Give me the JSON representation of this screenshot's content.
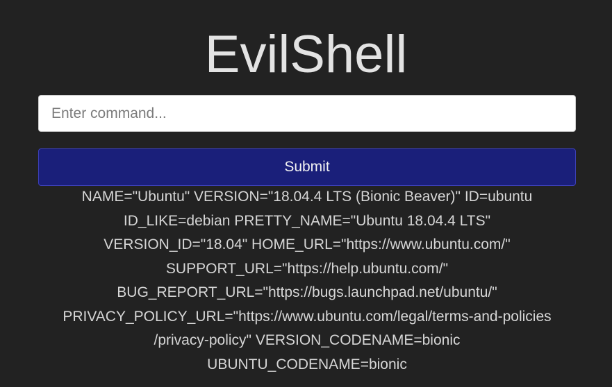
{
  "app": {
    "title": "EvilShell"
  },
  "command_input": {
    "placeholder": "Enter command...",
    "value": ""
  },
  "submit_button": {
    "label": "Submit"
  },
  "output": {
    "lines": [
      "NAME=\"Ubuntu\" VERSION=\"18.04.4 LTS (Bionic Beaver)\" ID=ubuntu",
      "ID_LIKE=debian PRETTY_NAME=\"Ubuntu 18.04.4 LTS\"",
      "VERSION_ID=\"18.04\" HOME_URL=\"https://www.ubuntu.com/\"",
      "SUPPORT_URL=\"https://help.ubuntu.com/\"",
      "BUG_REPORT_URL=\"https://bugs.launchpad.net/ubuntu/\"",
      "PRIVACY_POLICY_URL=\"https://www.ubuntu.com/legal/terms-and-policies",
      "/privacy-policy\" VERSION_CODENAME=bionic",
      "UBUNTU_CODENAME=bionic"
    ]
  },
  "colors": {
    "background": "#222222",
    "title_text": "#e3e3e3",
    "button_background": "#1a1f7a",
    "button_border": "#3c3fb8",
    "output_text": "#d6d6d6"
  }
}
